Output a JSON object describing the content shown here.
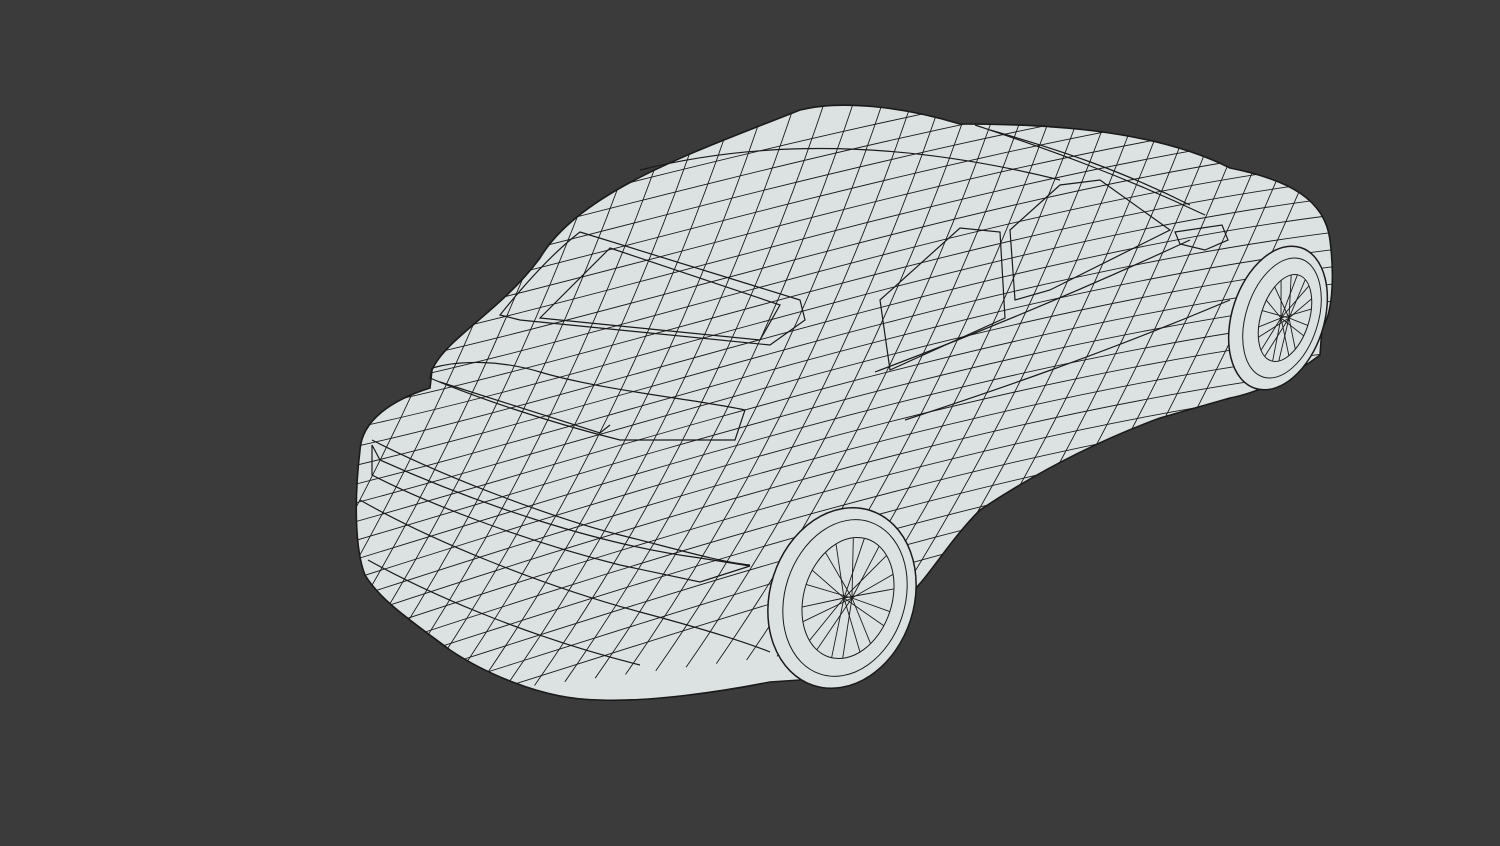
{
  "viewport": {
    "background_color": "#3b3b3b",
    "mesh_fill_color": "#dce2e1",
    "wire_color": "#1a1a1a",
    "display_mode": "wireframe-on-shaded"
  },
  "model": {
    "subject": "car",
    "visible_wheels": 2
  }
}
